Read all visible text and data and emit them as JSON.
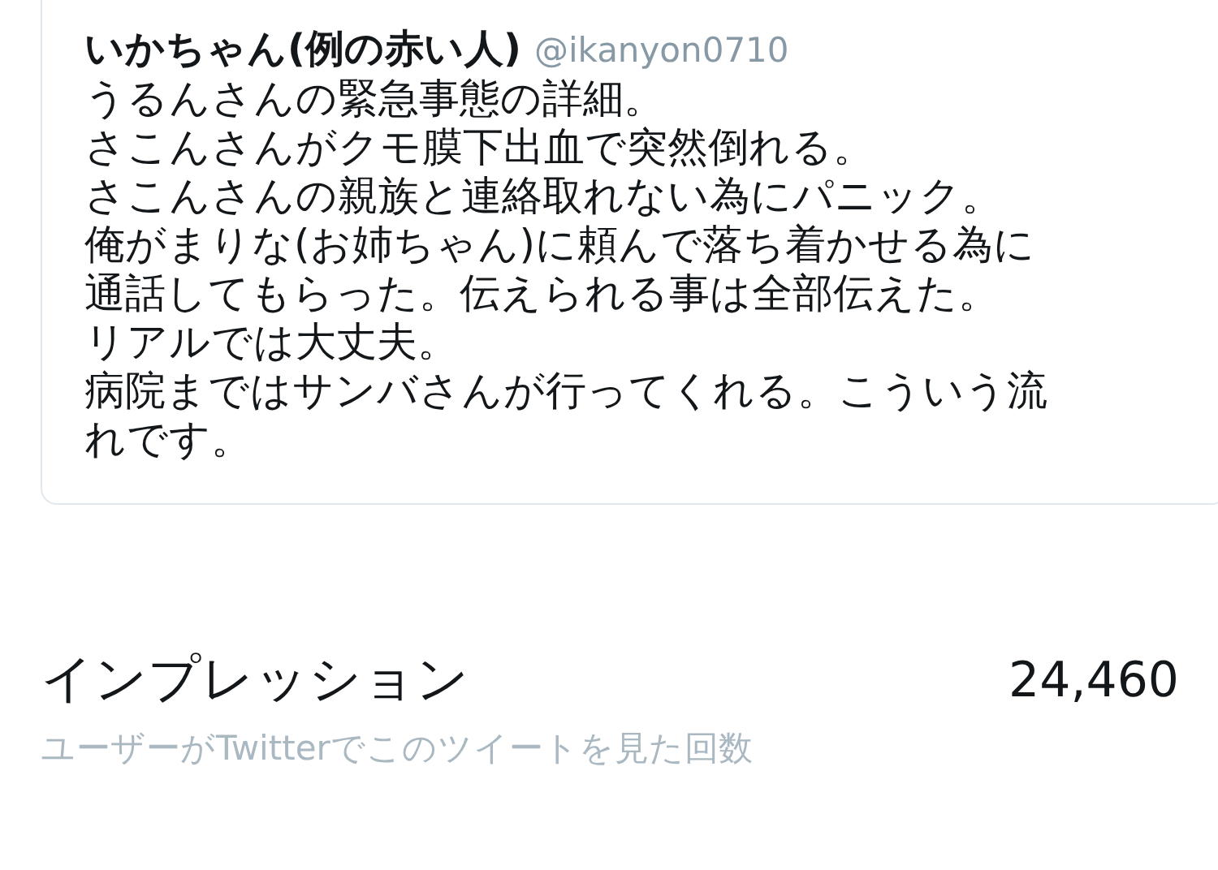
{
  "quoted_tweet": {
    "name": "いかちゃん(例の赤い人)",
    "handle": "@ikanyon0710",
    "lines": [
      "うるんさんの緊急事態の詳細。",
      "さこんさんがクモ膜下出血で突然倒れる。",
      "さこんさんの親族と連絡取れない為にパニック。",
      "俺がまりな(お姉ちゃん)に頼んで落ち着かせる為に",
      "通話してもらった。伝えられる事は全部伝えた。",
      "リアルでは大丈夫。",
      "病院まではサンバさんが行ってくれる。こういう流",
      "れです。"
    ]
  },
  "impressions": {
    "label": "インプレッション",
    "value": "24,460",
    "description": "ユーザーがTwitterでこのツイートを見た回数"
  }
}
